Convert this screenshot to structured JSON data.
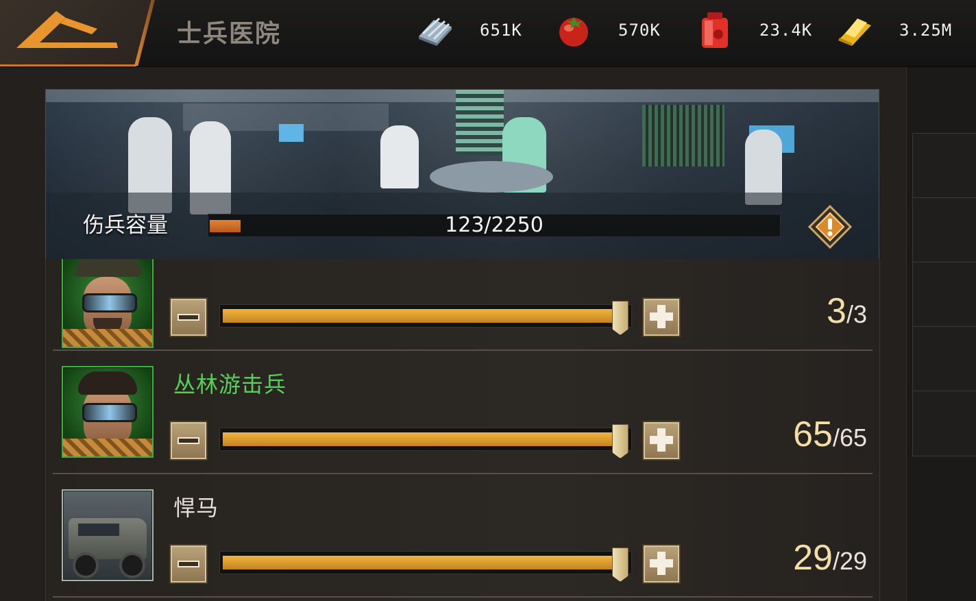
{
  "header": {
    "title": "士兵医院",
    "resources": [
      {
        "icon": "steel-icon",
        "value": "651K"
      },
      {
        "icon": "tomato-food-icon",
        "value": "570K"
      },
      {
        "icon": "fuel-can-icon",
        "value": "23.4K"
      },
      {
        "icon": "gold-bar-icon",
        "value": "3.25M"
      }
    ]
  },
  "banner": {
    "capacity_label": "伤兵容量",
    "capacity_text": "123/2250",
    "capacity_current": 123,
    "capacity_max": 2250,
    "warning_icon": "exclamation-diamond-icon"
  },
  "units": [
    {
      "name": "",
      "current": "3",
      "max": "/3",
      "fill_fraction": 1.0,
      "name_color": "#57d05a",
      "portrait": "soldier-cap-goggles"
    },
    {
      "name": "丛林游击兵",
      "current": "65",
      "max": "/65",
      "fill_fraction": 1.0,
      "name_color": "#57d05a",
      "portrait": "soldier-goggles"
    },
    {
      "name": "悍马",
      "current": "29",
      "max": "/29",
      "fill_fraction": 1.0,
      "name_color": "#e6e2da",
      "portrait": "humvee-vehicle"
    }
  ],
  "colors": {
    "accent_orange": "#e08a33",
    "slider_gold": "#f2b43f",
    "green_name": "#57d05a"
  }
}
